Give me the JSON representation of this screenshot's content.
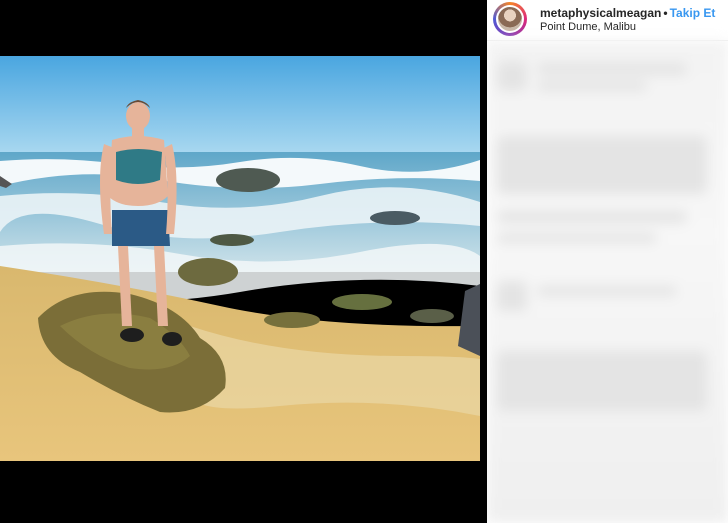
{
  "post": {
    "username": "metaphysicalmeagan",
    "separator": "•",
    "follow_label": "Takip Et",
    "location": "Point Dume, Malibu"
  },
  "icons": {
    "avatar": "profile-avatar"
  },
  "colors": {
    "follow": "#3897f0",
    "text": "#262626",
    "panel_bg": "#ffffff",
    "letterbox": "#000000"
  }
}
